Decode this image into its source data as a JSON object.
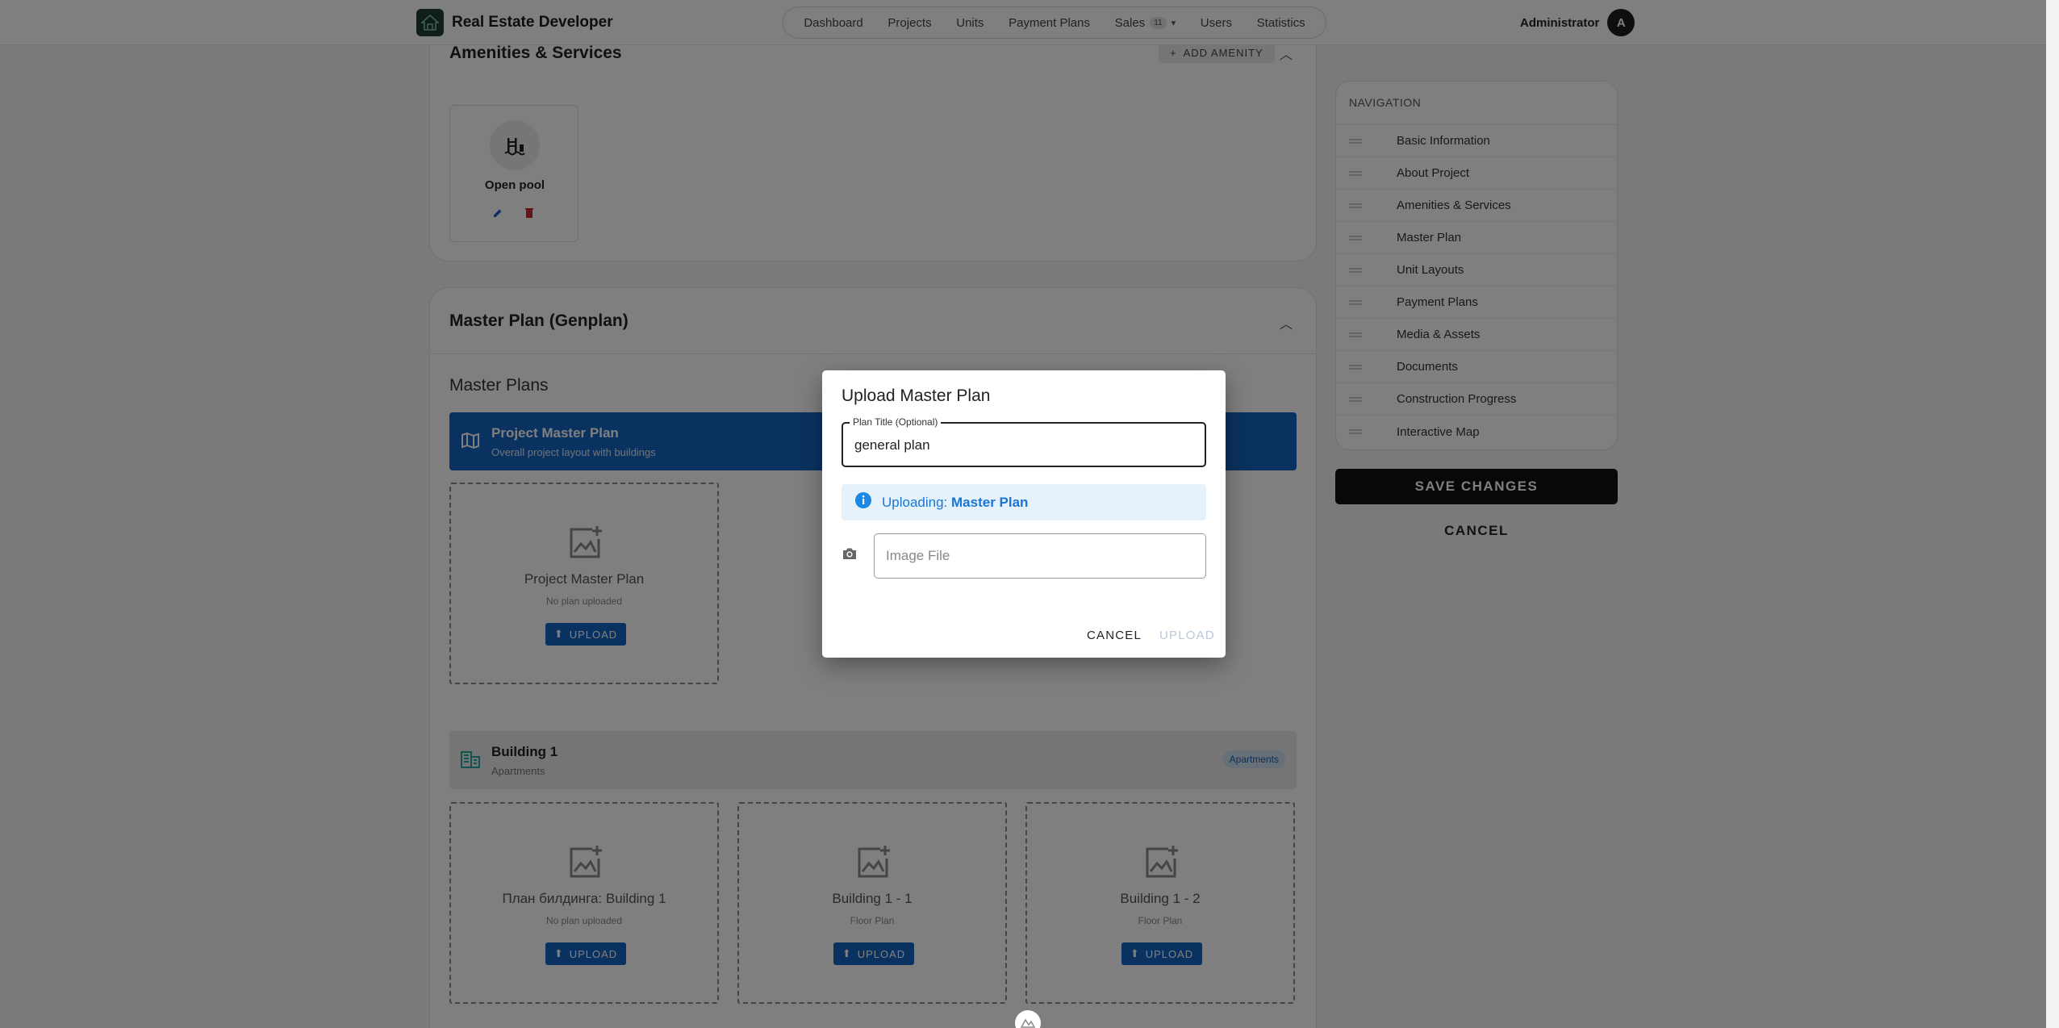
{
  "app": {
    "title": "Real Estate Developer"
  },
  "nav": {
    "items": [
      "Dashboard",
      "Projects",
      "Units",
      "Payment Plans",
      "Sales",
      "Users",
      "Statistics"
    ],
    "sales_badge": "11"
  },
  "user": {
    "name": "Administrator",
    "initial": "A"
  },
  "amenities": {
    "title": "Amenities & Services",
    "add_label": "ADD AMENITY",
    "items": [
      {
        "name": "Open pool"
      }
    ]
  },
  "master": {
    "title": "Master Plan (Genplan)",
    "plans_heading": "Master Plans",
    "project_plan": {
      "title": "Project Master Plan",
      "subtitle": "Overall project layout with buildings"
    },
    "project_box": {
      "title": "Project Master Plan",
      "subtitle": "No plan uploaded",
      "button": "UPLOAD"
    },
    "building": {
      "name": "Building 1",
      "type": "Apartments",
      "badge": "Apartments"
    },
    "building_boxes": [
      {
        "title": "План билдинга: Building 1",
        "subtitle": "No plan uploaded",
        "button": "UPLOAD"
      },
      {
        "title": "Building 1 - 1",
        "subtitle": "Floor Plan",
        "button": "UPLOAD"
      },
      {
        "title": "Building 1 - 2",
        "subtitle": "Floor Plan",
        "button": "UPLOAD"
      }
    ]
  },
  "sidebar": {
    "heading": "NAVIGATION",
    "items": [
      "Basic Information",
      "About Project",
      "Amenities & Services",
      "Master Plan",
      "Unit Layouts",
      "Payment Plans",
      "Media & Assets",
      "Documents",
      "Construction Progress",
      "Interactive Map"
    ],
    "save_label": "SAVE CHANGES",
    "cancel_label": "CANCEL"
  },
  "dialog": {
    "title": "Upload Master Plan",
    "title_field": {
      "label": "Plan Title (Optional)",
      "value": "general plan"
    },
    "info_prefix": "Uploading:",
    "info_value": "Master Plan",
    "file_field": {
      "placeholder": "Image File"
    },
    "cancel_label": "CANCEL",
    "upload_label": "UPLOAD"
  }
}
